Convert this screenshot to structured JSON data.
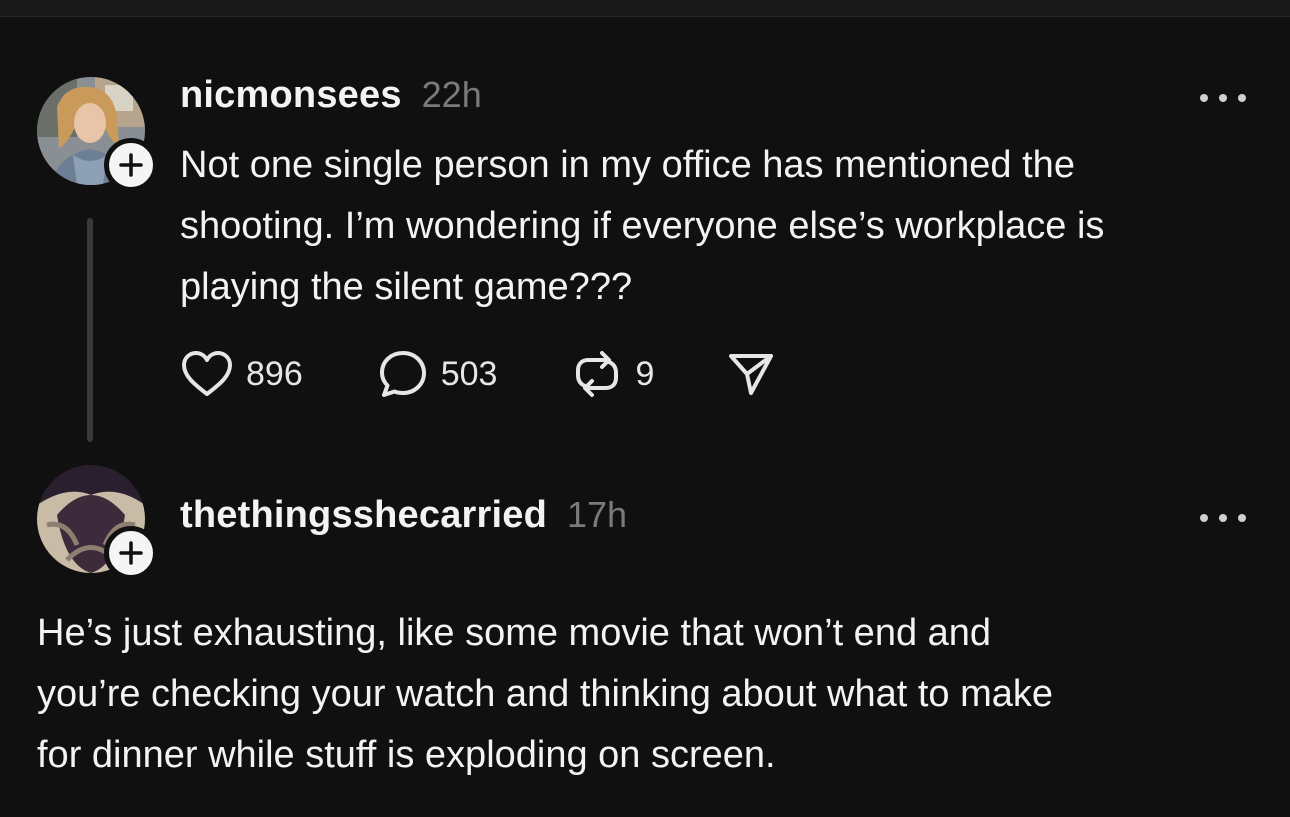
{
  "posts": [
    {
      "username": "nicmonsees",
      "time": "22h",
      "text": "Not one single person in my office has mentioned the\nshooting. I’m wondering if everyone else’s workplace is\nplaying the silent game???",
      "actions": {
        "likes": "896",
        "replies": "503",
        "reposts": "9"
      },
      "icons": {
        "avatar": "user-avatar",
        "follow": "plus-icon",
        "more": "more-horizontal-icon",
        "like": "heart-icon",
        "reply": "comment-bubble-icon",
        "repost": "repost-icon",
        "share": "send-icon"
      }
    },
    {
      "username": "thethingsshecarried",
      "time": "17h",
      "text": "He’s just exhausting, like some movie that won’t end and\nyou’re checking your watch and thinking about what to make\nfor dinner while stuff is exploding on screen.",
      "icons": {
        "avatar": "user-avatar",
        "follow": "plus-icon",
        "more": "more-horizontal-icon"
      }
    }
  ],
  "colors": {
    "background": "#101010",
    "text": "#f3f3f3",
    "muted": "#7a7a7a",
    "thread_line": "#3a3a3a"
  }
}
